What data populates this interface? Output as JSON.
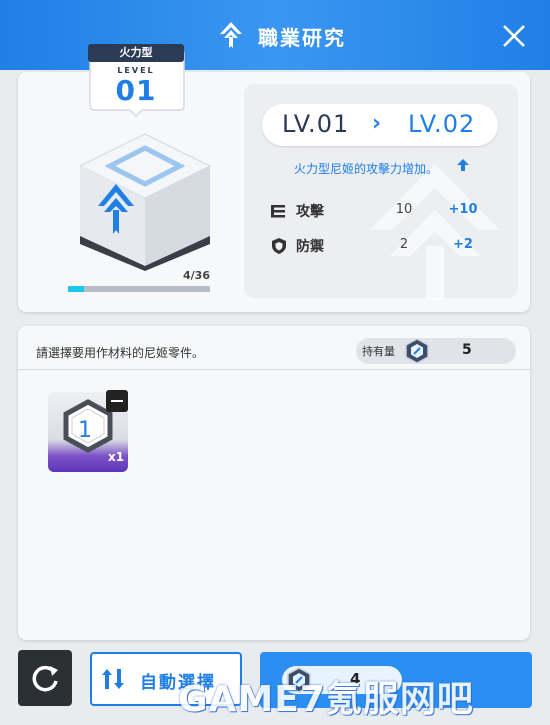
{
  "header": {
    "title": "職業研究",
    "logo_icon": "class-emblem-icon",
    "close_icon": "close-icon"
  },
  "class_tag": {
    "type": "火力型",
    "level_word": "LEVEL",
    "level": "01"
  },
  "progress": {
    "text": "4/36",
    "current": 4,
    "max": 36
  },
  "levels": {
    "from": "LV.01",
    "arrow": "›",
    "to": "LV.02"
  },
  "effect": {
    "text": "火力型尼姬的攻擊力增加。",
    "icon": "arrow-up-icon"
  },
  "stats": [
    {
      "name": "攻擊",
      "icon": "attack-icon",
      "current": "10",
      "next": "+10"
    },
    {
      "name": "防禦",
      "icon": "shield-icon",
      "current": "2",
      "next": "+2"
    }
  ],
  "materials": {
    "prompt": "請選擇要用作材料的尼姬零件。",
    "held_label": "持有量",
    "held_count": "5",
    "parts": [
      {
        "number": "1",
        "qty": "x1"
      }
    ]
  },
  "footer": {
    "auto_label": "自動選擇",
    "research_cost": "4"
  },
  "watermark": "GAME7氪服网吧",
  "colors": {
    "accent": "#1f7fe6",
    "header": "#2a8ff0",
    "progress": "#19c8ef",
    "dark": "#2b3a55"
  }
}
